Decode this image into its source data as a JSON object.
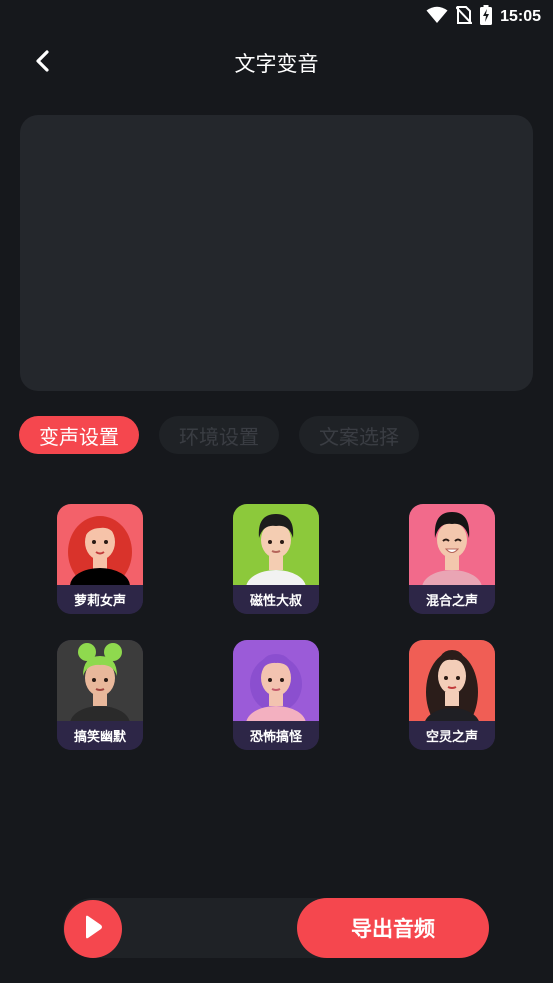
{
  "status_bar": {
    "time": "15:05",
    "icons": [
      "wifi-icon",
      "no-sim-icon",
      "battery-charging-icon"
    ]
  },
  "header": {
    "title": "文字变音",
    "back_icon": "chevron-left-icon"
  },
  "text_panel": {
    "value": ""
  },
  "tabs": [
    {
      "label": "变声设置",
      "active": true
    },
    {
      "label": "环境设置",
      "active": false
    },
    {
      "label": "文案选择",
      "active": false
    }
  ],
  "voices": [
    {
      "label": "萝莉女声",
      "bg": "#f3616a",
      "hair": "#d9332b",
      "skin": "#f6c3a9"
    },
    {
      "label": "磁性大叔",
      "bg": "#8cc93b",
      "hair": "#1c1c1c",
      "skin": "#f4cdb2"
    },
    {
      "label": "混合之声",
      "bg": "#f26a8b",
      "hair": "#141414",
      "skin": "#f3c7ad"
    },
    {
      "label": "搞笑幽默",
      "bg": "#3c3c3c",
      "hair": "#8fd94e",
      "skin": "#e9b89b"
    },
    {
      "label": "恐怖搞怪",
      "bg": "#9b5bd8",
      "hair": "#8b4fcf",
      "skin": "#f3c3b0"
    },
    {
      "label": "空灵之声",
      "bg": "#f05e55",
      "hair": "#2b1d1a",
      "skin": "#f3cdb8"
    }
  ],
  "bottom": {
    "play_icon": "play-icon",
    "export_label": "导出音频"
  },
  "colors": {
    "accent": "#f5474e",
    "background": "#16181c",
    "panel": "#24272c",
    "card_label_bg": "#2d2647"
  }
}
